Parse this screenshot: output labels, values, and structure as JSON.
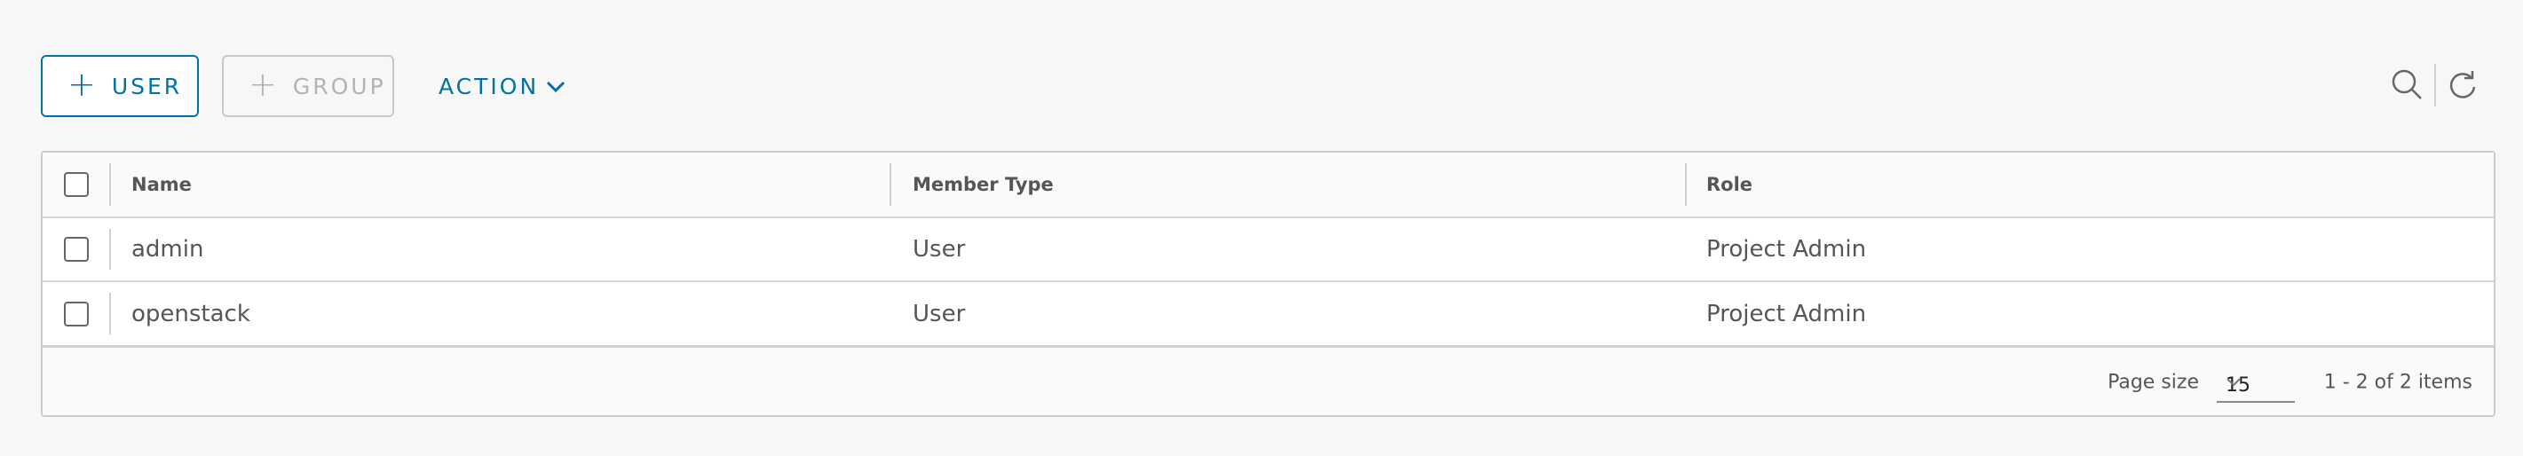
{
  "toolbar": {
    "user_button_label": "USER",
    "group_button_label": "GROUP",
    "action_button_label": "ACTION"
  },
  "grid": {
    "columns": [
      "Name",
      "Member Type",
      "Role"
    ],
    "rows": [
      {
        "name": "admin",
        "member_type": "User",
        "role": "Project Admin"
      },
      {
        "name": "openstack",
        "member_type": "User",
        "role": "Project Admin"
      }
    ],
    "footer": {
      "page_size_label": "Page size",
      "page_size_value": "15",
      "item_count": "1 - 2 of 2 items"
    }
  },
  "colors": {
    "accent": "#0072a3",
    "disabled": "#b3b3b3",
    "text": "#565656"
  },
  "icons": [
    "plus-icon",
    "chevron-down-icon",
    "search-icon",
    "refresh-icon"
  ]
}
